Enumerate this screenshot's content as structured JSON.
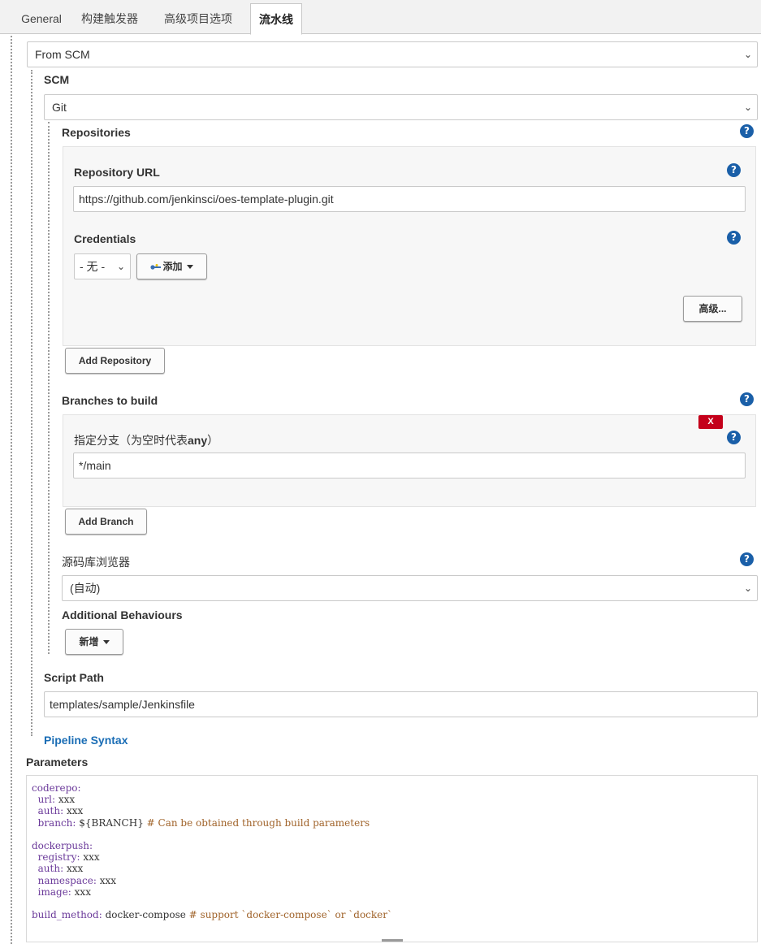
{
  "tabs": [
    {
      "label": "General"
    },
    {
      "label": "构建触发器"
    },
    {
      "label": "高级项目选项"
    },
    {
      "label": "流水线"
    }
  ],
  "definition": {
    "selected": "From SCM"
  },
  "scm": {
    "label": "SCM",
    "selected": "Git",
    "repositories": {
      "label": "Repositories",
      "url_label": "Repository URL",
      "url_value": "https://github.com/jenkinsci/oes-template-plugin.git",
      "credentials_label": "Credentials",
      "credentials_selected": "- 无 -",
      "add_label": "添加",
      "advanced_label": "高级...",
      "add_repository_label": "Add Repository"
    },
    "branches": {
      "label": "Branches to build",
      "delete_label": "X",
      "specifier_label_prefix": "指定分支（为空时代表",
      "specifier_label_bold": "any",
      "specifier_label_suffix": "）",
      "specifier_value": "*/main",
      "add_branch_label": "Add Branch"
    },
    "browser": {
      "label": "源码库浏览器",
      "selected": "(自动)"
    },
    "behaviours": {
      "label": "Additional Behaviours",
      "add_label": "新增"
    }
  },
  "script_path": {
    "label": "Script Path",
    "value": "templates/sample/Jenkinsfile"
  },
  "pipeline_syntax_label": "Pipeline Syntax",
  "parameters": {
    "label": "Parameters",
    "lines": [
      "coderepo:",
      "  url: xxx",
      "  auth: xxx",
      "  branch: ${BRANCH} # Can be obtained through build parameters",
      "",
      "dockerpush:",
      "  registry: xxx",
      "  auth: xxx",
      "  namespace: xxx",
      "  image: xxx",
      "",
      "build_method: docker-compose # support `docker-compose` or `docker`"
    ]
  },
  "help_icon_glyph": "?",
  "colors": {
    "accent": "#1a5fa8",
    "danger": "#c4001a",
    "link": "#1a6db5"
  }
}
